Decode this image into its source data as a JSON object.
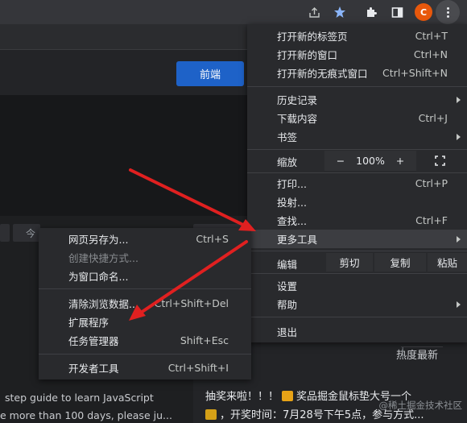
{
  "toolbar": {
    "icons": [
      "share-icon",
      "star-icon",
      "extensions-icon",
      "sidepanel-icon"
    ],
    "avatar_letter": "C",
    "avatar_color": "#e8580c"
  },
  "page": {
    "frontend_button": "前端",
    "chip_today": "今",
    "article_lines": [
      "step guide to learn JavaScript",
      "e more than 100 days, please ju..."
    ],
    "hot_label": "热度",
    "latest_label": "最新",
    "promo_line1_a": "抽奖来啦！！！",
    "promo_line1_b": "奖品掘金鼠标垫大号一个",
    "promo_line2": "，开奖时间：7月28号下午5点，参与方式...",
    "watermark": "@稀土掘金技术社区"
  },
  "main_menu": {
    "new_tab": {
      "label": "打开新的标签页",
      "shortcut": "Ctrl+T"
    },
    "new_window": {
      "label": "打开新的窗口",
      "shortcut": "Ctrl+N"
    },
    "incognito": {
      "label": "打开新的无痕式窗口",
      "shortcut": "Ctrl+Shift+N"
    },
    "history": {
      "label": "历史记录"
    },
    "downloads": {
      "label": "下载内容",
      "shortcut": "Ctrl+J"
    },
    "bookmarks": {
      "label": "书签"
    },
    "zoom": {
      "label": "缩放",
      "minus": "−",
      "value": "100%",
      "plus": "+"
    },
    "print": {
      "label": "打印...",
      "shortcut": "Ctrl+P"
    },
    "cast": {
      "label": "投射..."
    },
    "find": {
      "label": "查找...",
      "shortcut": "Ctrl+F"
    },
    "more_tools": {
      "label": "更多工具"
    },
    "edit": {
      "label": "编辑",
      "cut": "剪切",
      "copy": "复制",
      "paste": "粘贴"
    },
    "settings": {
      "label": "设置"
    },
    "help": {
      "label": "帮助"
    },
    "exit": {
      "label": "退出"
    }
  },
  "sub_menu": {
    "save_page": {
      "label": "网页另存为...",
      "shortcut": "Ctrl+S"
    },
    "create_shortcut": {
      "label": "创建快捷方式..."
    },
    "name_window": {
      "label": "为窗口命名..."
    },
    "clear_data": {
      "label": "清除浏览数据...",
      "shortcut": "Ctrl+Shift+Del"
    },
    "extensions": {
      "label": "扩展程序"
    },
    "task_manager": {
      "label": "任务管理器",
      "shortcut": "Shift+Esc"
    },
    "dev_tools": {
      "label": "开发者工具",
      "shortcut": "Ctrl+Shift+I"
    }
  },
  "colors": {
    "menu_bg": "#292a2d",
    "highlight": "#3c3d41",
    "annotation_arrow": "#e02020",
    "accent": "#1e62c8"
  }
}
